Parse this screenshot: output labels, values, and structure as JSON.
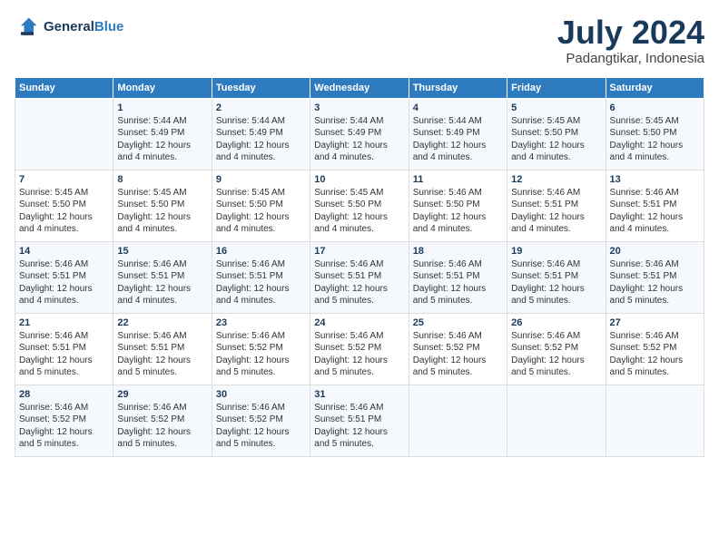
{
  "header": {
    "logo_line1": "General",
    "logo_line2": "Blue",
    "month": "July 2024",
    "location": "Padangtikar, Indonesia"
  },
  "days_of_week": [
    "Sunday",
    "Monday",
    "Tuesday",
    "Wednesday",
    "Thursday",
    "Friday",
    "Saturday"
  ],
  "weeks": [
    [
      {
        "num": "",
        "info": ""
      },
      {
        "num": "1",
        "info": "Sunrise: 5:44 AM\nSunset: 5:49 PM\nDaylight: 12 hours\nand 4 minutes."
      },
      {
        "num": "2",
        "info": "Sunrise: 5:44 AM\nSunset: 5:49 PM\nDaylight: 12 hours\nand 4 minutes."
      },
      {
        "num": "3",
        "info": "Sunrise: 5:44 AM\nSunset: 5:49 PM\nDaylight: 12 hours\nand 4 minutes."
      },
      {
        "num": "4",
        "info": "Sunrise: 5:44 AM\nSunset: 5:49 PM\nDaylight: 12 hours\nand 4 minutes."
      },
      {
        "num": "5",
        "info": "Sunrise: 5:45 AM\nSunset: 5:50 PM\nDaylight: 12 hours\nand 4 minutes."
      },
      {
        "num": "6",
        "info": "Sunrise: 5:45 AM\nSunset: 5:50 PM\nDaylight: 12 hours\nand 4 minutes."
      }
    ],
    [
      {
        "num": "7",
        "info": "Sunrise: 5:45 AM\nSunset: 5:50 PM\nDaylight: 12 hours\nand 4 minutes."
      },
      {
        "num": "8",
        "info": "Sunrise: 5:45 AM\nSunset: 5:50 PM\nDaylight: 12 hours\nand 4 minutes."
      },
      {
        "num": "9",
        "info": "Sunrise: 5:45 AM\nSunset: 5:50 PM\nDaylight: 12 hours\nand 4 minutes."
      },
      {
        "num": "10",
        "info": "Sunrise: 5:45 AM\nSunset: 5:50 PM\nDaylight: 12 hours\nand 4 minutes."
      },
      {
        "num": "11",
        "info": "Sunrise: 5:46 AM\nSunset: 5:50 PM\nDaylight: 12 hours\nand 4 minutes."
      },
      {
        "num": "12",
        "info": "Sunrise: 5:46 AM\nSunset: 5:51 PM\nDaylight: 12 hours\nand 4 minutes."
      },
      {
        "num": "13",
        "info": "Sunrise: 5:46 AM\nSunset: 5:51 PM\nDaylight: 12 hours\nand 4 minutes."
      }
    ],
    [
      {
        "num": "14",
        "info": "Sunrise: 5:46 AM\nSunset: 5:51 PM\nDaylight: 12 hours\nand 4 minutes."
      },
      {
        "num": "15",
        "info": "Sunrise: 5:46 AM\nSunset: 5:51 PM\nDaylight: 12 hours\nand 4 minutes."
      },
      {
        "num": "16",
        "info": "Sunrise: 5:46 AM\nSunset: 5:51 PM\nDaylight: 12 hours\nand 4 minutes."
      },
      {
        "num": "17",
        "info": "Sunrise: 5:46 AM\nSunset: 5:51 PM\nDaylight: 12 hours\nand 5 minutes."
      },
      {
        "num": "18",
        "info": "Sunrise: 5:46 AM\nSunset: 5:51 PM\nDaylight: 12 hours\nand 5 minutes."
      },
      {
        "num": "19",
        "info": "Sunrise: 5:46 AM\nSunset: 5:51 PM\nDaylight: 12 hours\nand 5 minutes."
      },
      {
        "num": "20",
        "info": "Sunrise: 5:46 AM\nSunset: 5:51 PM\nDaylight: 12 hours\nand 5 minutes."
      }
    ],
    [
      {
        "num": "21",
        "info": "Sunrise: 5:46 AM\nSunset: 5:51 PM\nDaylight: 12 hours\nand 5 minutes."
      },
      {
        "num": "22",
        "info": "Sunrise: 5:46 AM\nSunset: 5:51 PM\nDaylight: 12 hours\nand 5 minutes."
      },
      {
        "num": "23",
        "info": "Sunrise: 5:46 AM\nSunset: 5:52 PM\nDaylight: 12 hours\nand 5 minutes."
      },
      {
        "num": "24",
        "info": "Sunrise: 5:46 AM\nSunset: 5:52 PM\nDaylight: 12 hours\nand 5 minutes."
      },
      {
        "num": "25",
        "info": "Sunrise: 5:46 AM\nSunset: 5:52 PM\nDaylight: 12 hours\nand 5 minutes."
      },
      {
        "num": "26",
        "info": "Sunrise: 5:46 AM\nSunset: 5:52 PM\nDaylight: 12 hours\nand 5 minutes."
      },
      {
        "num": "27",
        "info": "Sunrise: 5:46 AM\nSunset: 5:52 PM\nDaylight: 12 hours\nand 5 minutes."
      }
    ],
    [
      {
        "num": "28",
        "info": "Sunrise: 5:46 AM\nSunset: 5:52 PM\nDaylight: 12 hours\nand 5 minutes."
      },
      {
        "num": "29",
        "info": "Sunrise: 5:46 AM\nSunset: 5:52 PM\nDaylight: 12 hours\nand 5 minutes."
      },
      {
        "num": "30",
        "info": "Sunrise: 5:46 AM\nSunset: 5:52 PM\nDaylight: 12 hours\nand 5 minutes."
      },
      {
        "num": "31",
        "info": "Sunrise: 5:46 AM\nSunset: 5:51 PM\nDaylight: 12 hours\nand 5 minutes."
      },
      {
        "num": "",
        "info": ""
      },
      {
        "num": "",
        "info": ""
      },
      {
        "num": "",
        "info": ""
      }
    ]
  ]
}
